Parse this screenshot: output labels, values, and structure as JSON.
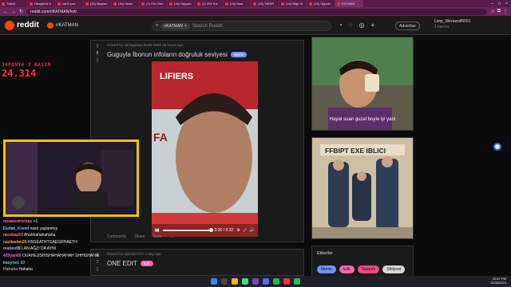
{
  "browser": {
    "tabs": [
      "Twitch",
      "Hikayeme b",
      "cardi pue",
      "(18) Naylad",
      "(16) Sesin",
      "(7) X'te Gün",
      "(16) Seyyan",
      "(1) X'te Kız",
      "(16) Nasi",
      "(16) 'NEDR",
      "(16) Bilgi Yo",
      "(16) Oğuzlu",
      "KATMAN"
    ],
    "url": "reddit.com/r/KATMAN/hot/"
  },
  "header": {
    "logo_text": "reddit",
    "subreddit": "r/KATMAN",
    "search_chip": "r/KATMAN",
    "search_placeholder": "Search Reddit",
    "advertise": "Advertise",
    "username": "Limp_Werewolf5091",
    "karma": "1 karma"
  },
  "overlay": {
    "line1": "JAPONYA 3 KASIM",
    "line2": "24.314"
  },
  "posts": [
    {
      "votes": "5",
      "meta": "Posted by u/Imaginary-Bank-9833 16 hours ago",
      "title": "Guguyla İbonun infoların doğruluk seviyesi",
      "flair": "Meme",
      "flair_color": "#7193ff",
      "video_time": "0:30 / 0:32",
      "actions": [
        "Comments",
        "Share",
        "Save",
        "…"
      ]
    },
    {
      "votes": "7",
      "meta": "Posted by u/yildirim707 1 day ago",
      "title": "ONE EDIT",
      "flair": "Edit",
      "flair_color": "#ff66ac"
    }
  ],
  "sidebar": {
    "image1_caption": "Hayat suan guzel boyle iyi yani",
    "image2_sign": "FFBIPT EXE IBLICI",
    "tags_title": "Etiketler",
    "tags": [
      {
        "label": "Meme",
        "color": "#7193ff"
      },
      {
        "label": "Edit",
        "color": "#ff66ac"
      },
      {
        "label": "Tasarım",
        "color": "#ff4585"
      },
      {
        "label": "Shitpost",
        "color": "#d7dadc"
      }
    ]
  },
  "chat": [
    {
      "name": "moawedriemas",
      "msg": "+1",
      "color": "#ff6b6b"
    },
    {
      "name": "Dudak_Kremi",
      "msg": "nasıl yaşlanmış",
      "color": "#8ab4ff"
    },
    {
      "name": "nazekaz53",
      "msg": "Ahahhahahahaha",
      "color": "#ff7a7a"
    },
    {
      "name": "nazliaslan20",
      "msg": "HSGEATHTGAEGRHAETH",
      "color": "#ffa14a"
    },
    {
      "name": "maitsu98",
      "msg": "LAN AĞZI DA AYNI",
      "color": "#8ab4ff"
    },
    {
      "name": "420yan69",
      "msg": "OUAHEJISHISHAHAHAHAH SHHISHAHAHAHA",
      "color": "#ff5bd1"
    },
    {
      "name": "kaoyne1",
      "msg": "10",
      "color": "#5bd1ff"
    },
    {
      "name": "Hahaha",
      "msg": "Hahaha",
      "color": "#9a9a9a"
    }
  ],
  "clock": {
    "time": "10:57 PM",
    "date": "10/26/2023"
  },
  "colors": {
    "reddit_orange": "#ff4500",
    "overlay_red": "#ff2e2e",
    "webcam_border": "#f2c200",
    "browser_tab": "#5a1a4a"
  }
}
